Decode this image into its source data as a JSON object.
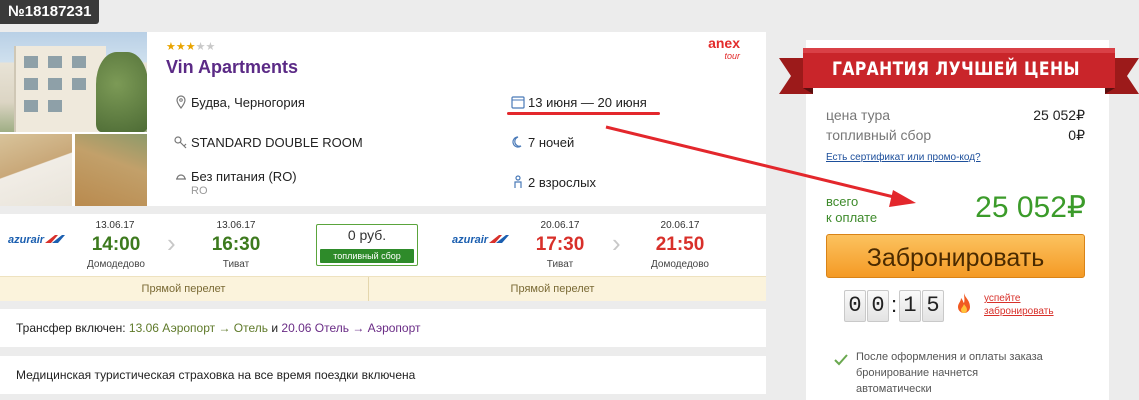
{
  "order_id": "№18187231",
  "hotel": {
    "stars_on": "★★★",
    "stars_off": "★★",
    "name": "Vin Apartments",
    "operator_logo": {
      "top": "anex",
      "bottom": "tour"
    },
    "location": "Будва, Черногория",
    "dates": "13 июня — 20 июня",
    "room": "STANDARD DOUBLE ROOM",
    "nights": "7 ночей",
    "meal": "Без питания (RO)",
    "meal_code": "RO",
    "guests": "2 взрослых"
  },
  "flights": {
    "outbound": {
      "airline": "azurair",
      "dep_date": "13.06.17",
      "dep_time": "14:00",
      "dep_place": "Домодедово",
      "arr_date": "13.06.17",
      "arr_time": "16:30",
      "arr_place": "Тиват",
      "direct": "Прямой перелет"
    },
    "fuel": {
      "price": "0 руб.",
      "label": "топливный сбор"
    },
    "return": {
      "airline": "azurair",
      "dep_date": "20.06.17",
      "dep_time": "17:30",
      "dep_place": "Тиват",
      "arr_date": "20.06.17",
      "arr_time": "21:50",
      "arr_place": "Домодедово",
      "direct": "Прямой перелет"
    }
  },
  "transfer": {
    "prefix": "Трансфер включен:",
    "leg1_date": "13.06",
    "leg1_route": "Аэропорт → Отель",
    "conj": "и",
    "leg2_date": "20.06",
    "leg2_route": "Отель → Аэропорт"
  },
  "insurance": "Медицинская туристическая страховка на все время поездки включена",
  "pricing": {
    "banner": "ГАРАНТИЯ ЛУЧШЕЙ ЦЕНЫ",
    "tour_price_label": "цена тура",
    "tour_price_value": "25 052₽",
    "fuel_label": "топливный сбор",
    "fuel_value": "0₽",
    "promo_link": "Есть сертификат или промо-код?",
    "total_label_1": "всего",
    "total_label_2": "к оплате",
    "total_value": "25 052₽",
    "book_button": "Забронировать",
    "timer": {
      "d1": "0",
      "d2": "0",
      "d3": "1",
      "d4": "5"
    },
    "hurry_1": "успейте",
    "hurry_2": "забронировать",
    "note_1": "После оформления и оплаты заказа",
    "note_2": "бронирование начнется",
    "note_3": "автоматически"
  },
  "colors": {
    "accent_red": "#e3272c",
    "button_orange": "#f49a25",
    "price_green": "#3b9b2a",
    "hotel_purple": "#5b2a86"
  }
}
